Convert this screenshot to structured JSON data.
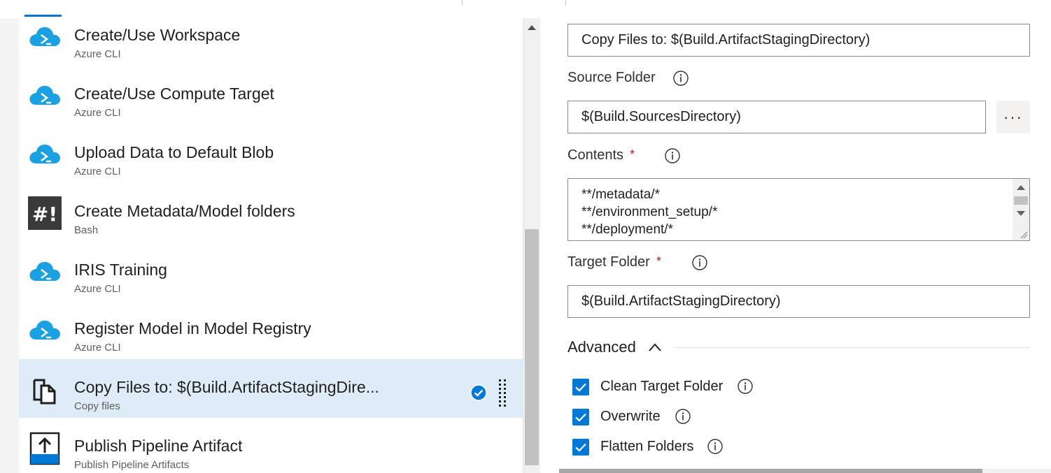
{
  "tasks": [
    {
      "name": "Create/Use Workspace",
      "type": "Azure CLI",
      "icon": "azure-cli-icon"
    },
    {
      "name": "Create/Use Compute Target",
      "type": "Azure CLI",
      "icon": "azure-cli-icon"
    },
    {
      "name": "Upload Data to Default Blob",
      "type": "Azure CLI",
      "icon": "azure-cli-icon"
    },
    {
      "name": "Create Metadata/Model folders",
      "type": "Bash",
      "icon": "bash-icon"
    },
    {
      "name": "IRIS Training",
      "type": "Azure CLI",
      "icon": "azure-cli-icon"
    },
    {
      "name": "Register Model in Model Registry",
      "type": "Azure CLI",
      "icon": "azure-cli-icon"
    },
    {
      "name": "Copy Files to: $(Build.ArtifactStagingDire...",
      "type": "Copy files",
      "icon": "copy-files-icon",
      "selected": true
    },
    {
      "name": "Publish Pipeline Artifact",
      "type": "Publish Pipeline Artifacts",
      "icon": "publish-artifact-icon"
    }
  ],
  "details": {
    "display_name": "Copy Files to: $(Build.ArtifactStagingDirectory)",
    "source_folder_label": "Source Folder",
    "source_folder_value": "$(Build.SourcesDirectory)",
    "browse_label": "···",
    "contents_label": "Contents",
    "required_mark": "*",
    "contents_lines": [
      "**/metadata/*",
      "**/environment_setup/*",
      "**/deployment/*"
    ],
    "target_folder_label": "Target Folder",
    "target_folder_value": "$(Build.ArtifactStagingDirectory)",
    "advanced_label": "Advanced",
    "options": [
      {
        "label": "Clean Target Folder",
        "checked": true
      },
      {
        "label": "Overwrite",
        "checked": true
      },
      {
        "label": "Flatten Folders",
        "checked": true
      }
    ]
  },
  "colors": {
    "accent": "#0078d4",
    "selected_row": "#deecf9",
    "azure_cloud": "#1ba1e2",
    "required": "#a4262c"
  }
}
